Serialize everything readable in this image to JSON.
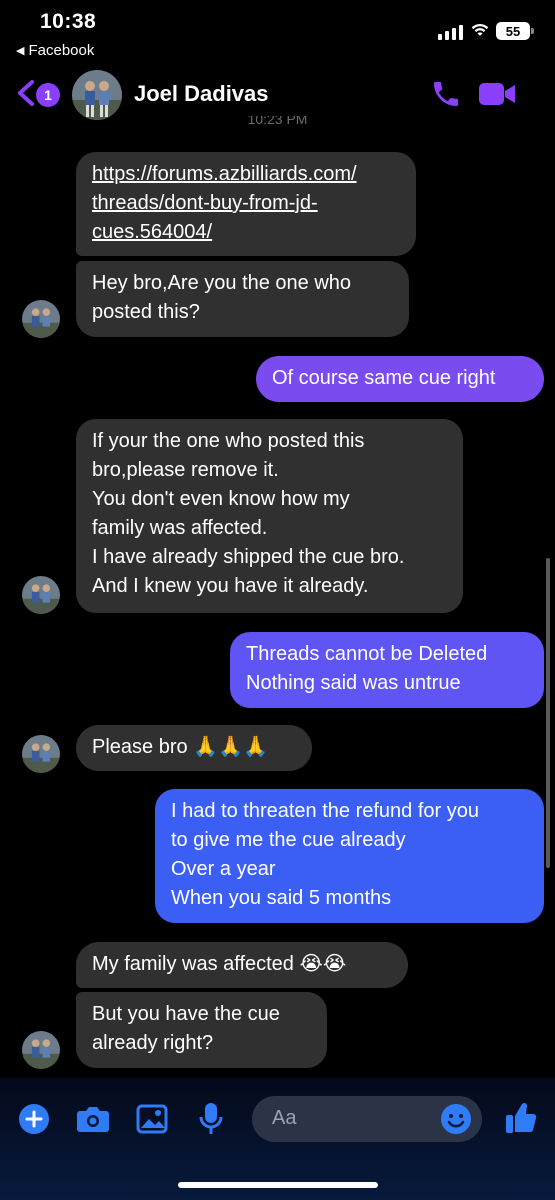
{
  "status_bar": {
    "time": "10:38",
    "back_app": "Facebook",
    "battery": "55"
  },
  "header": {
    "name": "Joel Dadivas",
    "unread_count": "1",
    "timestamp_peek": "10:23 PM"
  },
  "messages": [
    {
      "side": "in",
      "text": "https://forums.azbilliards.com/\nthreads/dont-buy-from-jd-\ncues.564004/"
    },
    {
      "side": "in",
      "text": "Hey bro,Are you the one who\nposted this?"
    },
    {
      "side": "out",
      "text": "Of course same cue right"
    },
    {
      "side": "in",
      "text": "If your the one who posted this\nbro,please remove it.\nYou don't even know how my\nfamily was affected.\nI have already shipped the cue bro.\nAnd I knew you have it already."
    },
    {
      "side": "out",
      "text": "Threads cannot be Deleted\nNothing said was untrue"
    },
    {
      "side": "in",
      "text": "Please bro 🙏🙏🙏"
    },
    {
      "side": "out",
      "text": "I had to threaten the refund for you\nto give me the cue already\nOver a year\nWhen you said 5 months"
    },
    {
      "side": "in",
      "text": "My family was affected 😭😭"
    },
    {
      "side": "in",
      "text": "But you have the cue\nalready right?"
    }
  ],
  "composer": {
    "placeholder": "Aa"
  },
  "colors": {
    "accent": "#8a3ffc",
    "incoming": "#303030",
    "outgoing_top": "#7a4cf0",
    "outgoing_bottom": "#3b5ff5"
  }
}
